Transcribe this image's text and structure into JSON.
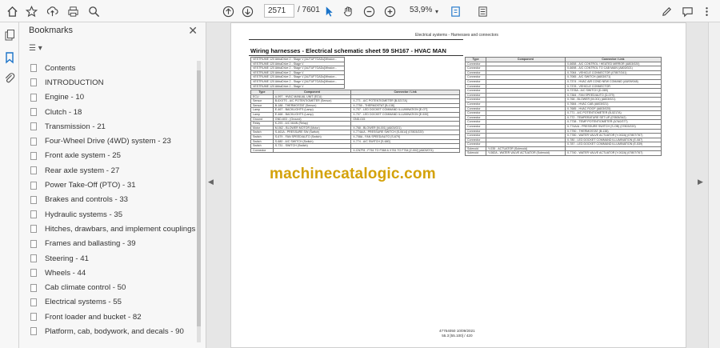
{
  "toolbar": {
    "page_current": "2571",
    "page_total": "/ 7601",
    "zoom": "53,9%",
    "icons": [
      "home-icon",
      "star-icon",
      "upload-icon",
      "print-icon",
      "search-icon",
      "page-up-icon",
      "page-down-icon",
      "select-icon",
      "hand-icon",
      "zoom-out-icon",
      "zoom-in-icon",
      "zoom-menu-icon",
      "fit-page-icon",
      "comment-icon",
      "pen-icon",
      "share-icon"
    ]
  },
  "sidebar": {
    "title": "Bookmarks",
    "close_label": "✕",
    "options_label": "☰ ▾",
    "items": [
      {
        "label": "Contents"
      },
      {
        "label": "INTRODUCTION"
      },
      {
        "label": "Engine - 10"
      },
      {
        "label": "Clutch - 18"
      },
      {
        "label": "Transmission - 21"
      },
      {
        "label": "Four-Wheel Drive (4WD) system - 23"
      },
      {
        "label": "Front axle system - 25"
      },
      {
        "label": "Rear axle system - 27"
      },
      {
        "label": "Power Take-Off (PTO) - 31"
      },
      {
        "label": "Brakes and controls - 33"
      },
      {
        "label": "Hydraulic systems - 35"
      },
      {
        "label": "Hitches, drawbars, and implement couplings - 37"
      },
      {
        "label": "Frames and ballasting - 39"
      },
      {
        "label": "Steering - 41"
      },
      {
        "label": "Wheels - 44"
      },
      {
        "label": "Cab climate control - 50"
      },
      {
        "label": "Electrical systems - 55"
      },
      {
        "label": "Front loader and bucket - 82"
      },
      {
        "label": "Platform, cab, bodywork, and decals - 90"
      }
    ]
  },
  "document": {
    "page_header": "Electrical systems - Harnesses and connectors",
    "title": "Wiring harnesses - Electrical schematic sheet 59 SH167 - HVAC MAN",
    "watermark": "machinecatalogic.com",
    "footer_line1": "47754050 10/09/2021",
    "footer_line2": "55.3 [55.100] / 420",
    "vest_rows": [
      "VESTRUME 120 AbbaDrive 2 - Stage V [AUTUF7GADu]Mission -",
      "VESTRUME 120 AbbaDrive 2 - Stage V",
      "VESTRUME 120 AbbaDrive 2 - Stage V [AUTUF7GADu]Mission -",
      "VESTRUME 120 AbbaDrive 2 - Stage V",
      "VESTRUME 120 AbbaDrive 2 - Stage V [AUTUF7GADu]Mission -",
      "VESTRUME 120 AbbaDrive 2 - Stage V [AUTUF7GADu]Mission -",
      "VESTRUME 120 AbbaDrive 2 - Stage V"
    ],
    "left_table": {
      "headers": [
        "Type",
        "Component",
        "Connector / Link"
      ],
      "rows": [
        [
          "ECU",
          "A-997 - HVAC MANUAL UNIT (ECU)",
          ""
        ],
        [
          "Sensor",
          "B-6XXTS - A/C POTENTIOMETER (Sensor)",
          "X-771 - A/C POTENTIOMETER [B-5217A]"
        ],
        [
          "Sensor",
          "B-188 - THERMOSTAT (Sensor)",
          "X-7750 - THERMOSTAT [B-138]"
        ],
        [
          "Lamp",
          "E-467 - BACKLIGHTS (Lamp)",
          "X-707 - LED DOCKET COMMAND ILLUMINATION [E-OT]"
        ],
        [
          "Lamp",
          "E-468 - BACKLIGHTS (Lamp)",
          "X-707 - LED DOCKET COMMAND ILLUMINATION [E-539]"
        ],
        [
          "Ground",
          "GND-603 - (Ground)",
          "GND-015"
        ],
        [
          "Relay",
          "K-293 - A/C MAIN (Relay)",
          ""
        ],
        [
          "Motor",
          "M-062 - BLOWER MOTOR (Motor)",
          "X-768 - BLOWER [M-001] (A603/021)"
        ],
        [
          "Switch",
          "S-461A - PRESSURE SW (Switch)",
          "X-774A/A - PRESSURE SWITCH [S-0614] (07803/220)"
        ],
        [
          "Switch",
          "S-679 - FAN SPEED/AUTO (Switch)",
          "X-708A - FAN SPEED/AUTO [S-679]"
        ],
        [
          "Switch",
          "S-680 - A/C SWITCH (Switch)",
          "X-774 - A/C SWITCH [S-680]"
        ],
        [
          "Switch",
          "S-731 - SWITCH (Switch)",
          ""
        ],
        [
          "Connector",
          "",
          "X-CN7F8 - F761 TO F368 & X761 TO F764 [Z-002] (A603/074)"
        ]
      ]
    },
    "right_table": {
      "headers": [
        "Type",
        "Component",
        "Connector / Link"
      ],
      "rows": [
        [
          "Connector",
          "",
          "X-6658 - A/C CONTROL / HEATED MIRROR (A803/020)"
        ],
        [
          "Connector",
          "",
          "X-6698 - A/C CONTROL TO CAB MAIN (A803/021)"
        ],
        [
          "Connector",
          "",
          "X-7064 - VEHICLE CONNECTOR (07807/341)"
        ],
        [
          "Connector",
          "",
          "X-7065 - A/C SWITCH (A603/071)"
        ],
        [
          "Connector",
          "",
          "X-7374 - HVAC AIR COND NEW COMAND (A8/09/048)"
        ],
        [
          "Connector",
          "",
          "X-7378 - VEHICLE CONNECTOR"
        ],
        [
          "Connector",
          "",
          "X-7378A - A/C SWITCH (D-089)"
        ],
        [
          "Connector",
          "",
          "X-7384 - FAN SPEED/AUTO (D-079)"
        ],
        [
          "Connector",
          "",
          "X-768 - BLOWER (M-001) (A603/021)"
        ],
        [
          "Connector",
          "",
          "X-7684 - HVAC CAB (A603/021)"
        ],
        [
          "Connector",
          "",
          "X-7685 - HVAC ROOF (A603/025)"
        ],
        [
          "Connector",
          "",
          "X-771 - A/C POTENTIOMETER (B-5217A)"
        ],
        [
          "Connector",
          "",
          "X-772 - TEMPERATURE SET UP (07805/342)"
        ],
        [
          "Connector",
          "",
          "X-7738 - TEMP POTENTIOMETER (A7A0/377)"
        ],
        [
          "Connector",
          "",
          "X-774A/A - PRESSURE SWITCH (S-OB) (07803/220)"
        ],
        [
          "Connector",
          "",
          "X-7750 - THERMOSTAT (B-138)"
        ],
        [
          "Connector",
          "",
          "X-7780 - WATER VALVE ACTUATOR [Y-002A] (07807/767)"
        ],
        [
          "Connector",
          "",
          "X-780 - LED DOCKET COMMAND ILLUMINATION (E-087)"
        ],
        [
          "Connector",
          "",
          "X-787 - LED DOCKET COMMAND ILLUMINATION (E-539)"
        ],
        [
          "Solenoid",
          "Y-035 - ACTUATOR (Solenoid)",
          ""
        ],
        [
          "Solenoid",
          "Y-082A - WATER VALVE ACTUATOR (Solenoid)",
          "X-7740 - WATER VALVE ACTUATOR [Y-002A] (07807/767)"
        ]
      ]
    }
  }
}
